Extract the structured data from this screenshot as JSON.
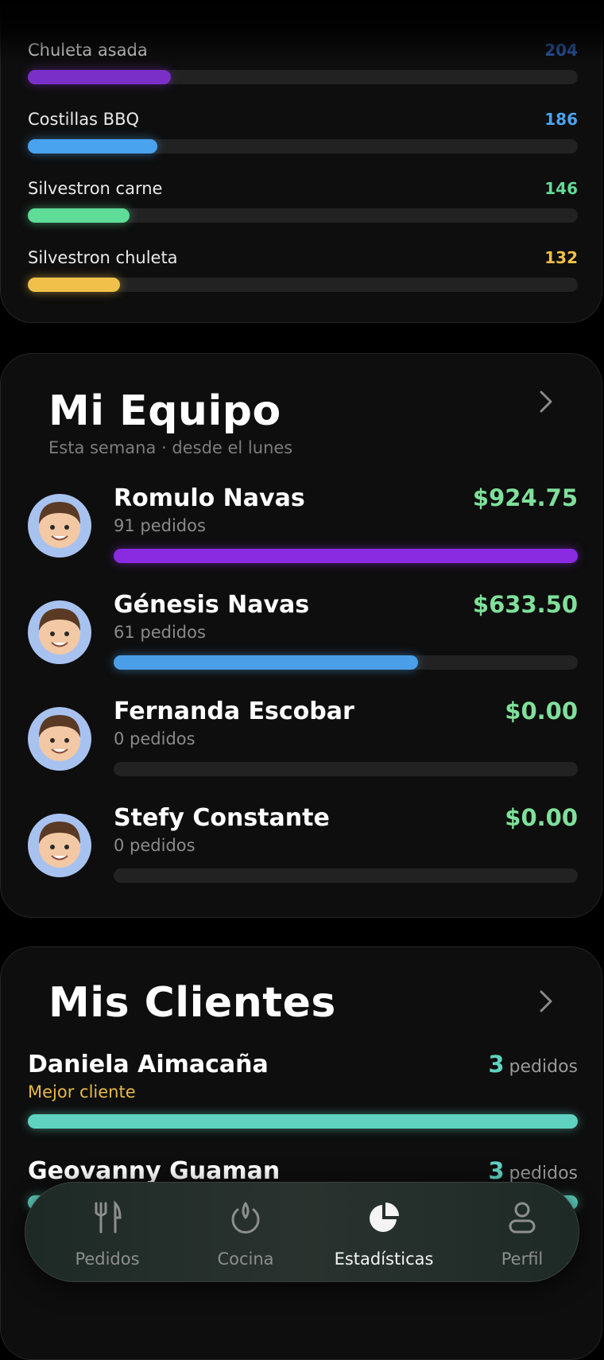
{
  "products": [
    {
      "name": "Chuleta asada",
      "value": "204",
      "color": "#7b2fc9",
      "fraction": 0.26
    },
    {
      "name": "Costillas BBQ",
      "value": "186",
      "color": "#4aa3ef",
      "fraction": 0.235
    },
    {
      "name": "Silvestron carne",
      "value": "146",
      "color": "#5fdc97",
      "fraction": 0.185
    },
    {
      "name": "Silvestron chuleta",
      "value": "132",
      "color": "#f0c04a",
      "fraction": 0.168
    }
  ],
  "team": {
    "title": "Mi Equipo",
    "subtitle": "Esta semana · desde el lunes",
    "members": [
      {
        "name": "Romulo Navas",
        "orders": "91 pedidos",
        "amount": "$924.75",
        "fraction": 1.0,
        "color": "#8a2be2"
      },
      {
        "name": "Génesis Navas",
        "orders": "61 pedidos",
        "amount": "$633.50",
        "fraction": 0.655,
        "color": "#4a9fe8"
      },
      {
        "name": "Fernanda Escobar",
        "orders": "0 pedidos",
        "amount": "$0.00",
        "fraction": 0,
        "color": "#4a9fe8"
      },
      {
        "name": "Stefy Constante",
        "orders": "0 pedidos",
        "amount": "$0.00",
        "fraction": 0,
        "color": "#4a9fe8"
      }
    ]
  },
  "clients": {
    "title": "Mis Clientes",
    "unit": "pedidos",
    "items": [
      {
        "name": "Daniela Aimacaña",
        "tag": "Mejor cliente",
        "count": "3",
        "fraction": 1.0,
        "color": "#5fd3c0"
      },
      {
        "name": "Geovanny Guaman",
        "tag": "",
        "count": "3",
        "fraction": 1.0,
        "color": "#5fd3c0"
      }
    ]
  },
  "tabs": [
    {
      "label": "Pedidos",
      "icon": "fork-knife-icon",
      "active": false
    },
    {
      "label": "Cocina",
      "icon": "flame-icon",
      "active": false
    },
    {
      "label": "Estadísticas",
      "icon": "pie-chart-icon",
      "active": true
    },
    {
      "label": "Perfil",
      "icon": "person-icon",
      "active": false
    }
  ]
}
